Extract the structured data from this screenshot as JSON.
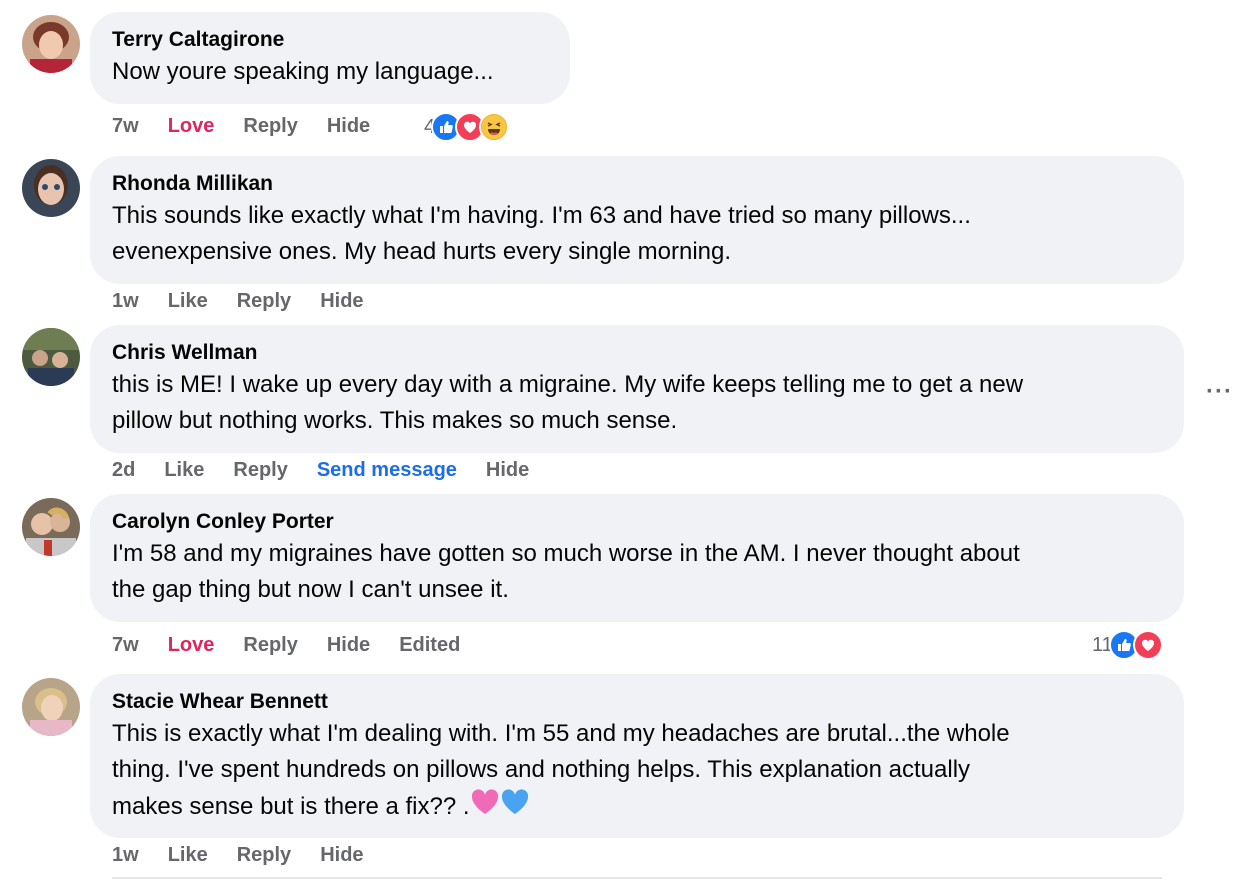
{
  "comments": [
    {
      "author": "Terry Caltagirone",
      "lines": [
        "Now youre speaking my language..."
      ],
      "time": "7w",
      "reaction_label": "Love",
      "reply": "Reply",
      "hide": "Hide",
      "reaction_count": "4"
    },
    {
      "author": "Rhonda Millikan",
      "lines": [
        "This sounds like exactly what I'm having. I'm 63 and have tried so many pillows...",
        "evenexpensive ones. My head hurts every single morning."
      ],
      "time": "1w",
      "reaction_label": "Like",
      "reply": "Reply",
      "hide": "Hide"
    },
    {
      "author": "Chris Wellman",
      "lines": [
        "this is ME! I wake up every day with a migraine. My wife keeps telling me to get a new",
        "pillow but nothing works. This makes so much sense."
      ],
      "time": "2d",
      "reaction_label": "Like",
      "reply": "Reply",
      "send_message": "Send message",
      "hide": "Hide"
    },
    {
      "author": "Carolyn Conley Porter",
      "lines": [
        "I'm 58 and my migraines have gotten so much worse in the AM. I never thought about",
        "the gap thing but now I can't unsee it."
      ],
      "time": "7w",
      "reaction_label": "Love",
      "reply": "Reply",
      "hide": "Hide",
      "edited": "Edited",
      "reaction_count": "11"
    },
    {
      "author": "Stacie Whear Bennett",
      "lines": [
        "This is exactly what I'm dealing with. I'm 55 and my headaches are brutal...the whole",
        "thing. I've spent hundreds on pillows and nothing helps. This explanation actually",
        "makes sense but is there a fix?? ."
      ],
      "time": "1w",
      "reaction_label": "Like",
      "reply": "Reply",
      "hide": "Hide"
    }
  ],
  "more_icon": "more-horizontal-icon",
  "colors": {
    "bubble": "#f0f2f5",
    "meta": "#65676b",
    "love": "#e0245e",
    "link": "#1b6ee6",
    "like_blue": "#1877f2",
    "love_red": "#f33e58",
    "haha_yellow": "#f7b125"
  }
}
